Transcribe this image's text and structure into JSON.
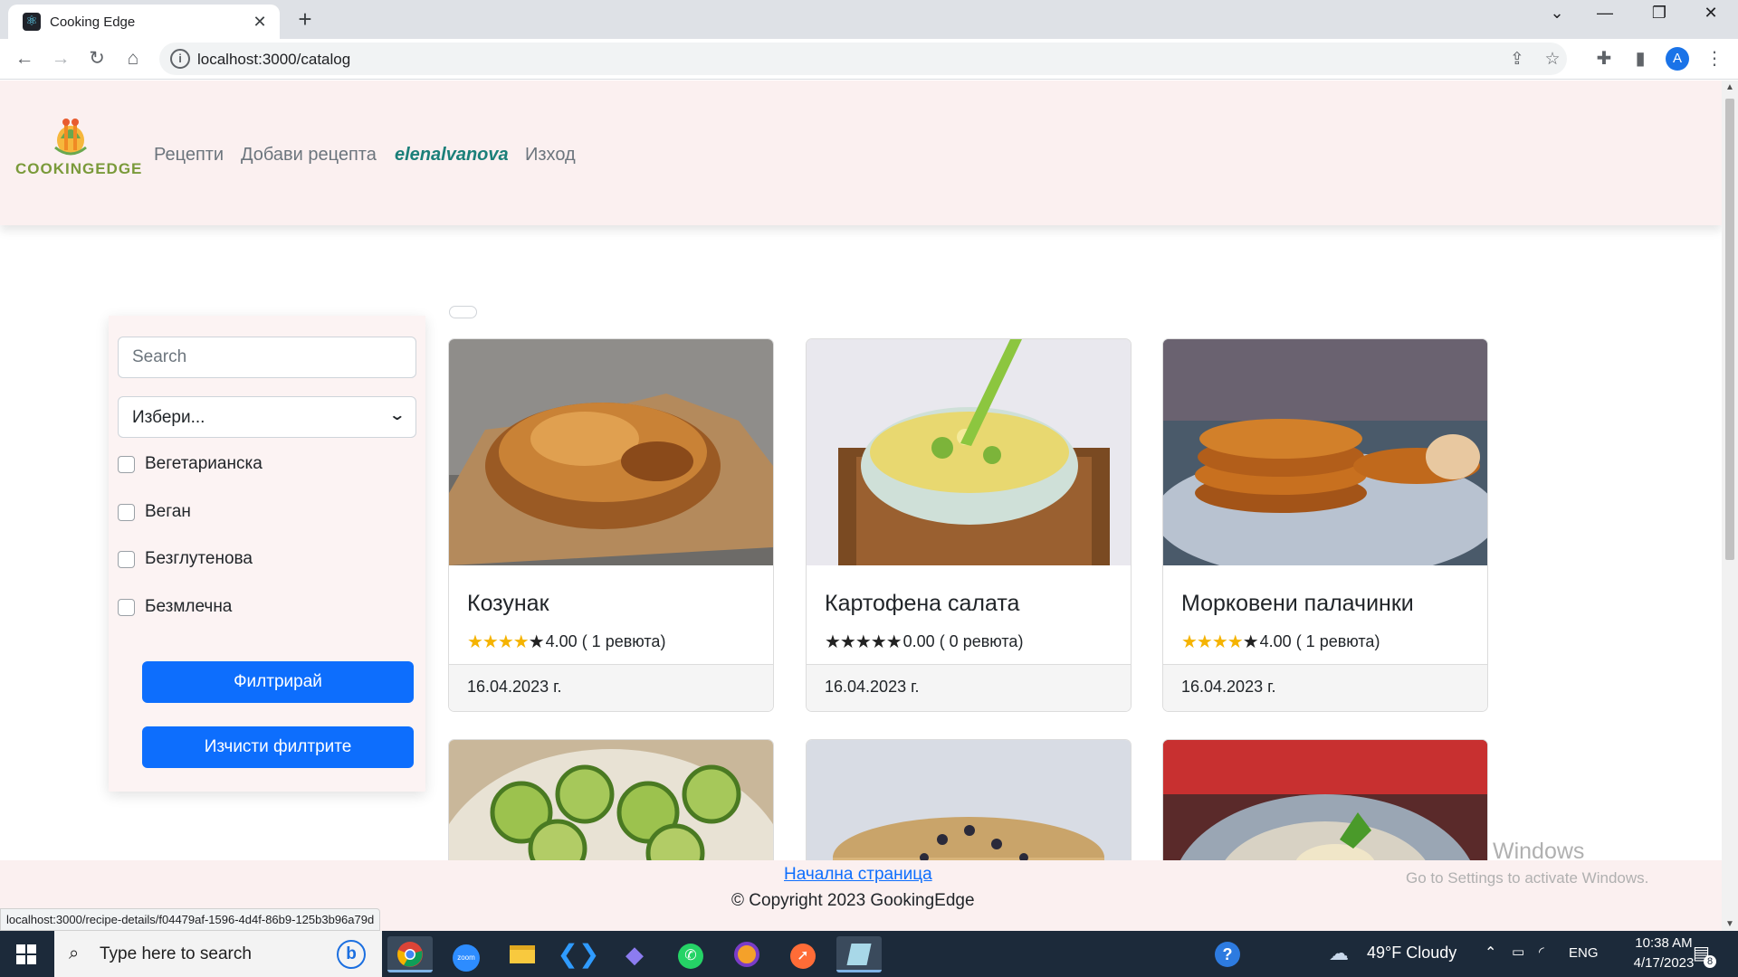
{
  "browser": {
    "tab_title": "Cooking Edge",
    "url": "localhost:3000/catalog",
    "profile_initial": "A"
  },
  "header": {
    "logo_text": "COOKINGEDGE",
    "nav": {
      "recipes": "Рецепти",
      "add_recipe": "Добави рецепта",
      "username": "elenalvanova",
      "logout": "Изход"
    }
  },
  "filter": {
    "search_placeholder": "Search",
    "select_value": "Избери...",
    "checkboxes": [
      {
        "label": "Вегетарианска",
        "checked": false
      },
      {
        "label": "Веган",
        "checked": false
      },
      {
        "label": "Безглутенова",
        "checked": false
      },
      {
        "label": "Безмлечна",
        "checked": false
      }
    ],
    "filter_button": "Филтрирай",
    "clear_button": "Изчисти филтрите"
  },
  "recipes": [
    {
      "title": "Козунак",
      "rating_text": "4.00 ( 1 ревюта)",
      "stars": 4,
      "date": "16.04.2023 г."
    },
    {
      "title": "Картофена салата",
      "rating_text": "0.00 ( 0 ревюта)",
      "stars": 0,
      "date": "16.04.2023 г."
    },
    {
      "title": "Морковени палачинки",
      "rating_text": "4.00 ( 1 ревюта)",
      "stars": 4,
      "date": "16.04.2023 г."
    }
  ],
  "footer": {
    "home_link": "Начална страница",
    "copyright": "© Copyright 2023 GookingEdge"
  },
  "watermark": {
    "line1": "Windows",
    "line2": "Go to Settings to activate Windows."
  },
  "status_bar_url": "localhost:3000/recipe-details/f04479af-1596-4d4f-86b9-125b3b96a79d",
  "taskbar": {
    "search_placeholder": "Type here to search",
    "weather": "49°F  Cloudy",
    "language": "ENG",
    "time": "10:38 AM",
    "date": "4/17/2023",
    "notifications": "8"
  }
}
